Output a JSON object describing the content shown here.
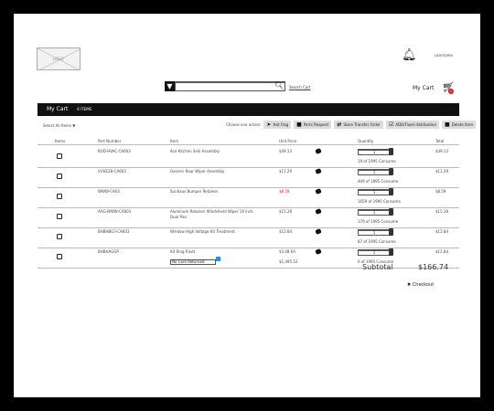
{
  "header": {
    "logo": "LOGO",
    "username": "username",
    "search_placeholder": "",
    "search_link": "Search Cart",
    "cart_label": "My Cart",
    "cart_badge": "0"
  },
  "bar": {
    "title": "My Cart",
    "count": "6 ITEMS"
  },
  "toolbar": {
    "select_all": "Select All Items",
    "choose": "Choose one action:",
    "actions": [
      {
        "icon": "rocket-icon",
        "label": "Hot Flag"
      },
      {
        "icon": "truck-icon",
        "label": "Parts Request"
      },
      {
        "icon": "transfer-icon",
        "label": "Store Transfer Order"
      },
      {
        "icon": "check-icon",
        "label": "ADD/Fixed distribution"
      },
      {
        "icon": "trash-icon",
        "label": "Delete Item"
      }
    ]
  },
  "columns": [
    "Items",
    "Part Number",
    "Item",
    "Unit Price",
    "Quantity",
    "Total"
  ],
  "rows": [
    {
      "part": "BUD-HVAC-CA603",
      "item": "Ace Kitchen Sink Assembly",
      "price": "$49.13",
      "price2": "",
      "qty": "1",
      "avail": "19 of 1995 Consume",
      "total": "$49.13"
    },
    {
      "part": "VUVE2B-CA603",
      "item": "Generic Rear Wiper Assembly",
      "price": "$11.29",
      "price2": "",
      "qty": "1",
      "avail": "409 of 1995 Consume",
      "total": "$11.29"
    },
    {
      "part": "WWW-CA03",
      "item": "Sunhaus Bumper Retainer",
      "price": "$8.59",
      "price2": "",
      "qty": "1",
      "avail": "1659 of 1995 Consume",
      "total": "$8.59",
      "red": true
    },
    {
      "part": "AAG-WWW-CA603",
      "item": "Aluminum Retainer Windshield Wiper 19 inch Dual Pins",
      "price": "$15.28",
      "price2": "",
      "qty": "1",
      "avail": "179 of 1995 Consume",
      "total": "$15.28"
    },
    {
      "part": "BHBHBG3-CA603",
      "item": "Window High Voltage Kit Treatment",
      "price": "$12.84",
      "price2": "",
      "qty": "1",
      "avail": "87 of 1995 Consume",
      "total": "$12.84"
    },
    {
      "part": "BHBHAGGP",
      "item": "Kit Ring Rivet",
      "price": "$3.48 EA",
      "price2": "$1,495.52",
      "qty": "1",
      "avail": "0 of 1995 Consume",
      "total": "$12.84",
      "select": "No Core Returned"
    }
  ],
  "summary": {
    "subtotal_label": "Subtotal",
    "subtotal": "$166.74",
    "checkout": "Checkout"
  },
  "colors": {
    "bar": "#111111",
    "red": "#e02020",
    "badge": "#e02020",
    "select_btn": "#1e90ff"
  }
}
